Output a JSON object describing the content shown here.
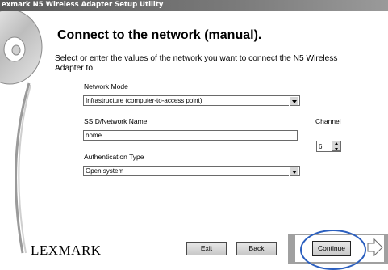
{
  "window": {
    "title": "exmark N5 Wireless Adapter Setup Utility"
  },
  "page": {
    "heading": "Connect to the network (manual).",
    "instructions": "Select or enter the values of the network you want to connect the N5 Wireless Adapter to."
  },
  "fields": {
    "network_mode": {
      "label": "Network Mode",
      "value": "Infrastructure (computer-to-access point)"
    },
    "ssid": {
      "label": "SSID/Network Name",
      "value": "home"
    },
    "channel": {
      "label": "Channel",
      "value": "6"
    },
    "auth": {
      "label": "Authentication Type",
      "value": "Open system"
    }
  },
  "footer": {
    "logo": "LEXMARK",
    "exit_label": "Exit",
    "back_label": "Back",
    "continue_label": "Continue"
  },
  "colors": {
    "highlight": "#2b5fbf",
    "title_bar": "#6a6a6a"
  },
  "icons": [
    "cd-disc-icon",
    "dropdown-arrow-icon",
    "spin-up-icon",
    "spin-down-icon",
    "next-arrow-icon"
  ]
}
